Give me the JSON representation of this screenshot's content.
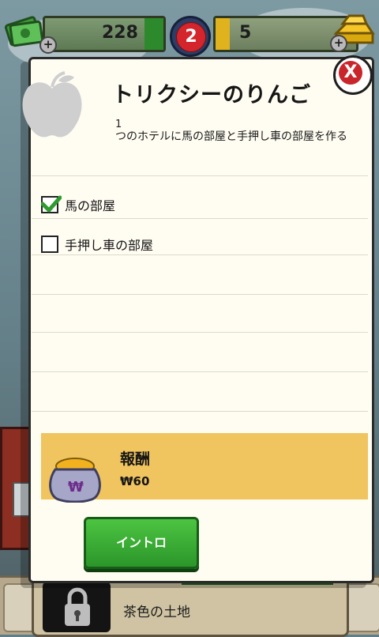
{
  "hud": {
    "cash_value": "228",
    "level_value": "2",
    "gold_value": "5",
    "plus_symbol": "+"
  },
  "modal": {
    "title": "トリクシーのりんご",
    "task_count": "1",
    "task_description": "つのホテルに馬の部屋と手押し車の部屋を作る",
    "tasks": [
      {
        "label": "馬の部屋",
        "checked": true
      },
      {
        "label": "手押し車の部屋",
        "checked": false
      }
    ],
    "reward": {
      "title": "報酬",
      "amount": "₩60"
    },
    "intro_button": "イントロ",
    "close_symbol": "X"
  },
  "background": {
    "bottom_item_label": "茶色の土地"
  },
  "icons": [
    "cash-icon",
    "gold-bars-icon",
    "apple-icon",
    "check-icon",
    "money-bag-icon",
    "lock-icon",
    "close-icon"
  ],
  "colors": {
    "accent_green": "#2b962a",
    "reward_band": "#f0c45e",
    "close_red": "#c9262b",
    "level_red": "#d3252b"
  }
}
